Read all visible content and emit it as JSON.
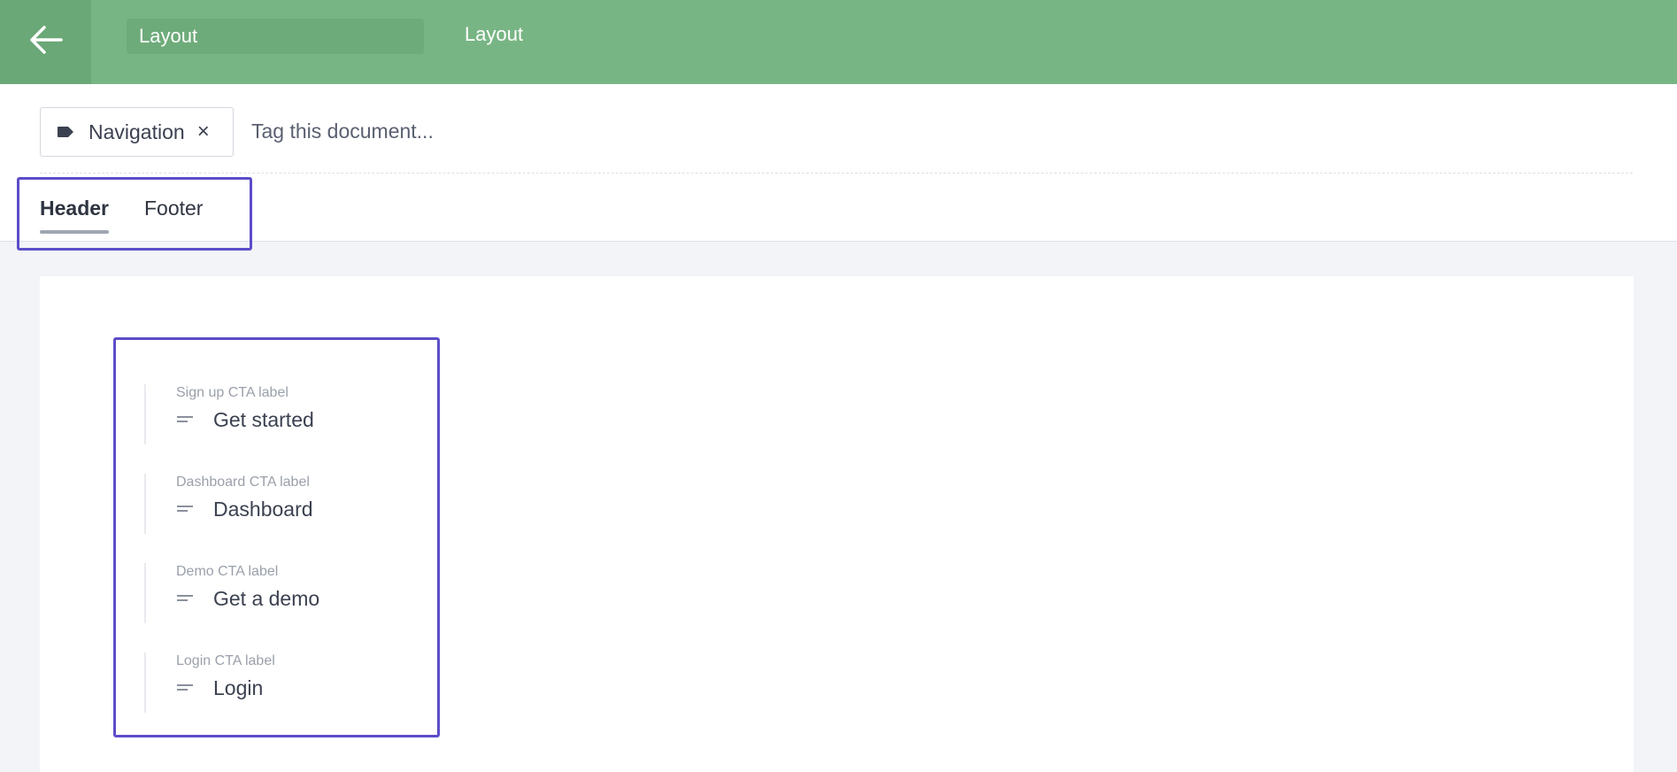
{
  "topbar": {
    "back_icon": "arrow-left-icon",
    "title_value": "Layout",
    "doc_type": "Layout",
    "accent_color": "#78b584"
  },
  "tags": {
    "chip_label": "Navigation",
    "chip_icon": "tag-icon",
    "remove_icon": "close-icon",
    "remove_glyph": "×",
    "input_placeholder": "Tag this document..."
  },
  "tabs": [
    {
      "label": "Header",
      "active": true
    },
    {
      "label": "Footer",
      "active": false
    }
  ],
  "fields": [
    {
      "label": "Sign up CTA label",
      "value": "Get started",
      "icon": "text-icon"
    },
    {
      "label": "Dashboard CTA label",
      "value": "Dashboard",
      "icon": "text-icon"
    },
    {
      "label": "Demo CTA label",
      "value": "Get a demo",
      "icon": "text-icon"
    },
    {
      "label": "Login CTA label",
      "value": "Login",
      "icon": "text-icon"
    }
  ],
  "highlight_color": "#5b4dc9"
}
